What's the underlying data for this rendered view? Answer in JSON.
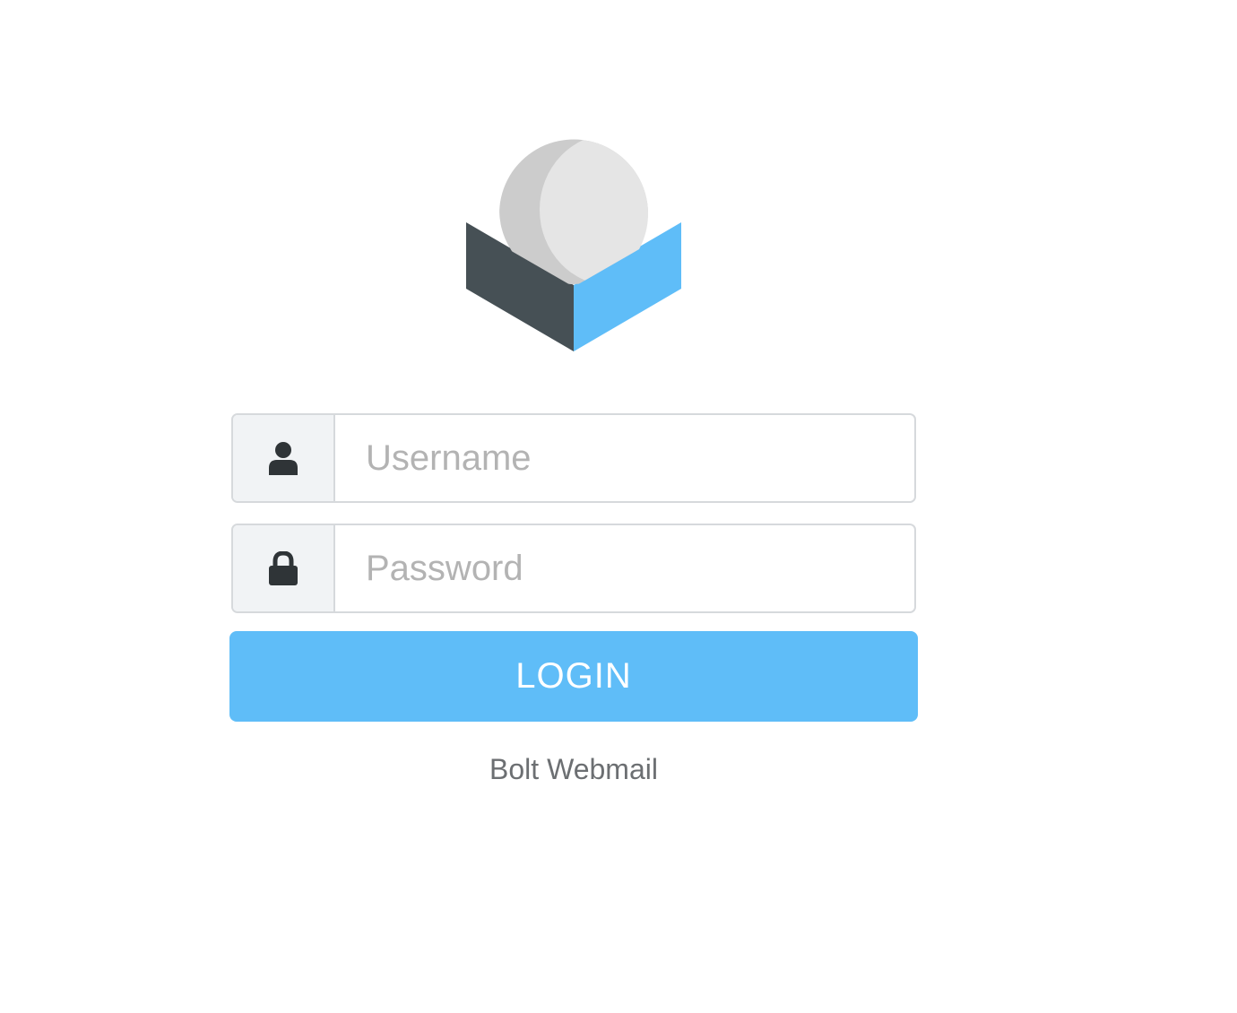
{
  "logo": {
    "icon": "roundcube-logo",
    "colors": {
      "box_left": "#465055",
      "box_right": "#5fbdf8",
      "sphere_light": "#e5e5e5",
      "sphere_shade": "#cccccc"
    }
  },
  "form": {
    "username": {
      "icon": "user-icon",
      "placeholder": "Username",
      "value": ""
    },
    "password": {
      "icon": "lock-icon",
      "placeholder": "Password",
      "value": ""
    },
    "login_label": "LOGIN"
  },
  "footer": {
    "product_name": "Bolt Webmail"
  },
  "colors": {
    "accent": "#5fbdf8",
    "icon_dark": "#2f3437",
    "addon_bg": "#f1f3f5",
    "border": "#d6d9dc"
  }
}
